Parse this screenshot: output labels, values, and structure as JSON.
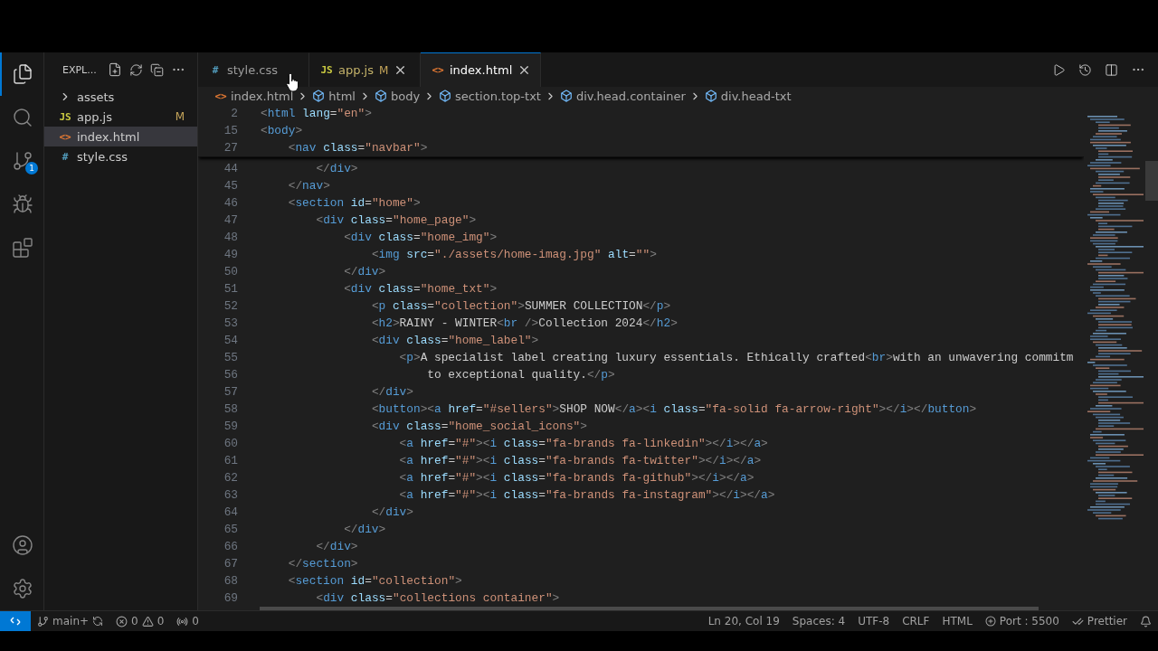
{
  "activity_bar": {
    "items": [
      {
        "kind": "explorer",
        "selected": true
      },
      {
        "kind": "search",
        "selected": false
      },
      {
        "kind": "source_control",
        "selected": false,
        "badge": "1"
      },
      {
        "kind": "run",
        "selected": false
      },
      {
        "kind": "extensions",
        "selected": false
      }
    ],
    "bottom": [
      {
        "kind": "account"
      },
      {
        "kind": "settings"
      }
    ]
  },
  "explorer": {
    "title": "EXPL...",
    "items": [
      {
        "kind": "folder",
        "name": "assets",
        "expanded": false,
        "selected": false
      },
      {
        "kind": "js",
        "icon": "JS",
        "name": "app.js",
        "status": "M",
        "selected": false
      },
      {
        "kind": "html",
        "icon": "<>",
        "name": "index.html",
        "selected": true
      },
      {
        "kind": "css",
        "icon": "#",
        "name": "style.css",
        "selected": false
      }
    ]
  },
  "tabs": [
    {
      "kind": "css",
      "icon": "#",
      "label": "style.css",
      "closable": false,
      "selected": false
    },
    {
      "kind": "js",
      "icon": "JS",
      "label": "app.js",
      "status": "M",
      "closable": true,
      "selected": false
    },
    {
      "kind": "html",
      "icon": "<>",
      "label": "index.html",
      "closable": true,
      "selected": true
    }
  ],
  "breadcrumb": [
    {
      "kind": "file",
      "icon": "<>",
      "label": "index.html"
    },
    {
      "kind": "element",
      "label": "html"
    },
    {
      "kind": "element",
      "label": "body"
    },
    {
      "kind": "element",
      "label": "section.top-txt"
    },
    {
      "kind": "element",
      "label": "div.head.container"
    },
    {
      "kind": "element",
      "label": "div.head-txt"
    }
  ],
  "editor": {
    "sticky": [
      {
        "number": "2",
        "code": "<html lang=\"en\">"
      },
      {
        "number": "15",
        "code": "<body>"
      },
      {
        "number": "27",
        "code": "    <nav class=\"navbar\">"
      }
    ],
    "lines": [
      {
        "number": "44",
        "code": "        </div>"
      },
      {
        "number": "45",
        "code": "    </nav>"
      },
      {
        "number": "46",
        "code": "    <section id=\"home\">"
      },
      {
        "number": "47",
        "code": "        <div class=\"home_page\">"
      },
      {
        "number": "48",
        "code": "            <div class=\"home_img\">"
      },
      {
        "number": "49",
        "code": "                <img src=\"./assets/home-imag.jpg\" alt=\"\">"
      },
      {
        "number": "50",
        "code": "            </div>"
      },
      {
        "number": "51",
        "code": "            <div class=\"home_txt\">"
      },
      {
        "number": "52",
        "code": "                <p class=\"collection\">SUMMER COLLECTION</p>"
      },
      {
        "number": "53",
        "code": "                <h2>RAINY - WINTER<br />Collection 2024</h2>"
      },
      {
        "number": "54",
        "code": "                <div class=\"home_label\">"
      },
      {
        "number": "55",
        "code": "                    <p>A specialist label creating luxury essentials. Ethically crafted<br>with an unwavering commitm"
      },
      {
        "number": "56",
        "code": "                        to exceptional quality.</p>"
      },
      {
        "number": "57",
        "code": "                </div>"
      },
      {
        "number": "58",
        "code": "                <button><a href=\"#sellers\">SHOP NOW</a><i class=\"fa-solid fa-arrow-right\"></i></button>"
      },
      {
        "number": "59",
        "code": "                <div class=\"home_social_icons\">"
      },
      {
        "number": "60",
        "code": "                    <a href=\"#\"><i class=\"fa-brands fa-linkedin\"></i></a>"
      },
      {
        "number": "61",
        "code": "                    <a href=\"#\"><i class=\"fa-brands fa-twitter\"></i></a>"
      },
      {
        "number": "62",
        "code": "                    <a href=\"#\"><i class=\"fa-brands fa-github\"></i></a>"
      },
      {
        "number": "63",
        "code": "                    <a href=\"#\"><i class=\"fa-brands fa-instagram\"></i></a>"
      },
      {
        "number": "64",
        "code": "                </div>"
      },
      {
        "number": "65",
        "code": "            </div>"
      },
      {
        "number": "66",
        "code": "        </div>"
      },
      {
        "number": "67",
        "code": "    </section>"
      },
      {
        "number": "68",
        "code": "    <section id=\"collection\">"
      },
      {
        "number": "69",
        "code": "        <div class=\"collections container\">"
      }
    ]
  },
  "status_bar": {
    "branch": "main+",
    "errors": "0",
    "warnings": "0",
    "ports": "0",
    "items": [
      "Ln 20, Col 19",
      "Spaces: 4",
      "UTF-8",
      "CRLF",
      "HTML"
    ],
    "port": "Port : 5500",
    "formatter": "Prettier"
  }
}
